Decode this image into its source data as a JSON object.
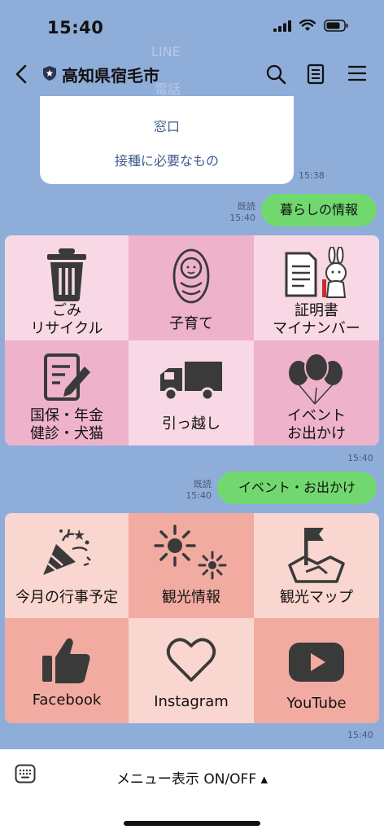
{
  "status": {
    "time": "15:40"
  },
  "header": {
    "title": "高知県宿毛市"
  },
  "faint": {
    "line1": "LINE",
    "line2": "電話"
  },
  "card": {
    "links": [
      "窓口",
      "接種に必要なもの"
    ],
    "time": "15:38"
  },
  "msg1": {
    "read": "既読",
    "time": "15:40",
    "text": "暮らしの情報"
  },
  "menu1": {
    "items": [
      {
        "label": "ごみ\nリサイクル",
        "icon": "trash-icon"
      },
      {
        "label": "子育て",
        "icon": "baby-icon"
      },
      {
        "label": "証明書\nマイナンバー",
        "icon": "document-mascot-icon"
      },
      {
        "label": "国保・年金\n健診・犬猫",
        "icon": "form-edit-icon"
      },
      {
        "label": "引っ越し",
        "icon": "truck-icon"
      },
      {
        "label": "イベント\nお出かけ",
        "icon": "balloons-icon"
      }
    ],
    "time": "15:40"
  },
  "msg2": {
    "read": "既読",
    "time": "15:40",
    "text": "イベント・お出かけ"
  },
  "menu2": {
    "items": [
      {
        "label": "今月の行事予定",
        "icon": "party-popper-icon"
      },
      {
        "label": "観光情報",
        "icon": "fireworks-icon"
      },
      {
        "label": "観光マップ",
        "icon": "map-flag-icon"
      },
      {
        "label": "Facebook",
        "icon": "thumbs-up-icon"
      },
      {
        "label": "Instagram",
        "icon": "heart-icon"
      },
      {
        "label": "YouTube",
        "icon": "youtube-icon"
      }
    ],
    "time": "15:40"
  },
  "footer": {
    "menu_toggle": "メニュー表示 ON/OFF ▴"
  },
  "colors": {
    "background": "#8fadd9",
    "bubble": "#71d870",
    "pink_light": "#f8d8e5",
    "pink_dark": "#eeb2cb",
    "salmon_light": "#f9d6cf",
    "salmon_dark": "#f2aba1"
  }
}
